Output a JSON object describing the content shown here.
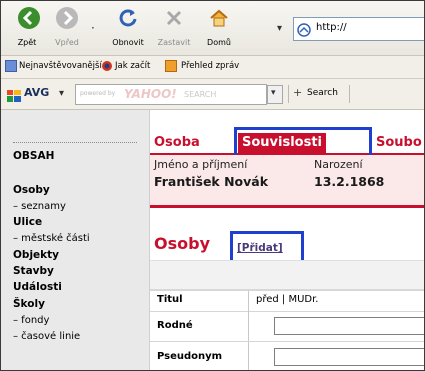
{
  "toolbar": {
    "back_label": "Zpět",
    "forward_label": "Vpřed",
    "refresh_label": "Obnovit",
    "stop_label": "Zastavit",
    "home_label": "Domů",
    "dropdown_glyph": "▾",
    "dot_glyph": "·"
  },
  "address": {
    "text": "http://"
  },
  "links_bar": {
    "items": [
      {
        "label": "Nejnavštěvovanější",
        "icon": "page-icon"
      },
      {
        "label": "Jak začít",
        "icon": "firefox-icon"
      },
      {
        "label": "Přehled zpráv",
        "icon": "rss-icon"
      }
    ]
  },
  "avg_bar": {
    "brand": "AVG",
    "search_placeholder": "powered by",
    "yahoo": "YAHOO!",
    "yahoo_search": "SEARCH",
    "search_button": "Search",
    "dropdown_glyph": "▾",
    "plus_glyph": "+"
  },
  "sidebar": {
    "heading": "OBSAH",
    "items": [
      {
        "label": "Osoby",
        "bold": true
      },
      {
        "label": "– seznamy",
        "bold": false
      },
      {
        "label": "Ulice",
        "bold": true
      },
      {
        "label": "– městské části",
        "bold": false
      },
      {
        "label": "Objekty",
        "bold": true
      },
      {
        "label": "Stavby",
        "bold": true
      },
      {
        "label": "Události",
        "bold": true
      },
      {
        "label": "Školy",
        "bold": true
      },
      {
        "label": "– fondy",
        "bold": false
      },
      {
        "label": "– časové linie",
        "bold": false
      }
    ]
  },
  "tabs": [
    {
      "label": "Osoba",
      "active": false
    },
    {
      "label": "Souvislosti",
      "active": true
    },
    {
      "label": "Soubo",
      "active": false
    }
  ],
  "person": {
    "name_header": "Jméno a příjmení",
    "birth_header": "Narození",
    "name": "František Novák",
    "birth": "13.2.1868"
  },
  "section": {
    "title": "Osoby",
    "add_link": "[Přidat]"
  },
  "form": {
    "rows": [
      {
        "label": "Titul",
        "value": "před | MUDr."
      },
      {
        "label": "Rodné",
        "value": ""
      },
      {
        "label": "Pseudonym",
        "value": ""
      }
    ]
  },
  "colors": {
    "accent": "#c8102e",
    "highlight": "#1f3fd0",
    "info_bg": "#fbe9e9"
  }
}
